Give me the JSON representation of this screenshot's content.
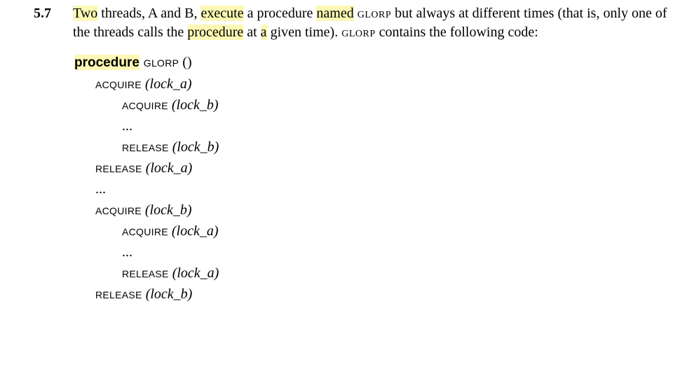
{
  "problem": {
    "number": "5.7",
    "text": {
      "seg1_hl": "Two",
      "seg2": " threads, A and B, ",
      "seg3_hl": "execute",
      "seg4": " a procedure ",
      "seg5_hl": "named",
      "seg6": " ",
      "seg7_sc": "glorp",
      "seg8": " but always at different times (that is, only one of the threads calls the ",
      "seg9_hl": "procedure",
      "seg10": " at ",
      "seg11_hl": "a",
      "seg12": " given time). ",
      "seg13_sc": "glorp",
      "seg14": " contains the following code:"
    }
  },
  "code": {
    "line1": {
      "kw_hl": "procedure",
      "fn": " glorp",
      "rest": " ()"
    },
    "line2": {
      "fn": "acquire",
      "arg": " (lock_a)"
    },
    "line3": {
      "fn": "acquire",
      "arg": " (lock_b)"
    },
    "line4": {
      "dots": "..."
    },
    "line5": {
      "fn": "release",
      "arg": " (lock_b)"
    },
    "line6": {
      "fn": "release",
      "arg": " (lock_a)"
    },
    "line7": {
      "dots": "..."
    },
    "line8": {
      "fn": "acquire",
      "arg": " (lock_b)"
    },
    "line9": {
      "fn": "acquire",
      "arg": " (lock_a)"
    },
    "line10": {
      "dots": "..."
    },
    "line11": {
      "fn": "release",
      "arg": " (lock_a)"
    },
    "line12": {
      "fn": "release",
      "arg": " (lock_b)"
    }
  }
}
